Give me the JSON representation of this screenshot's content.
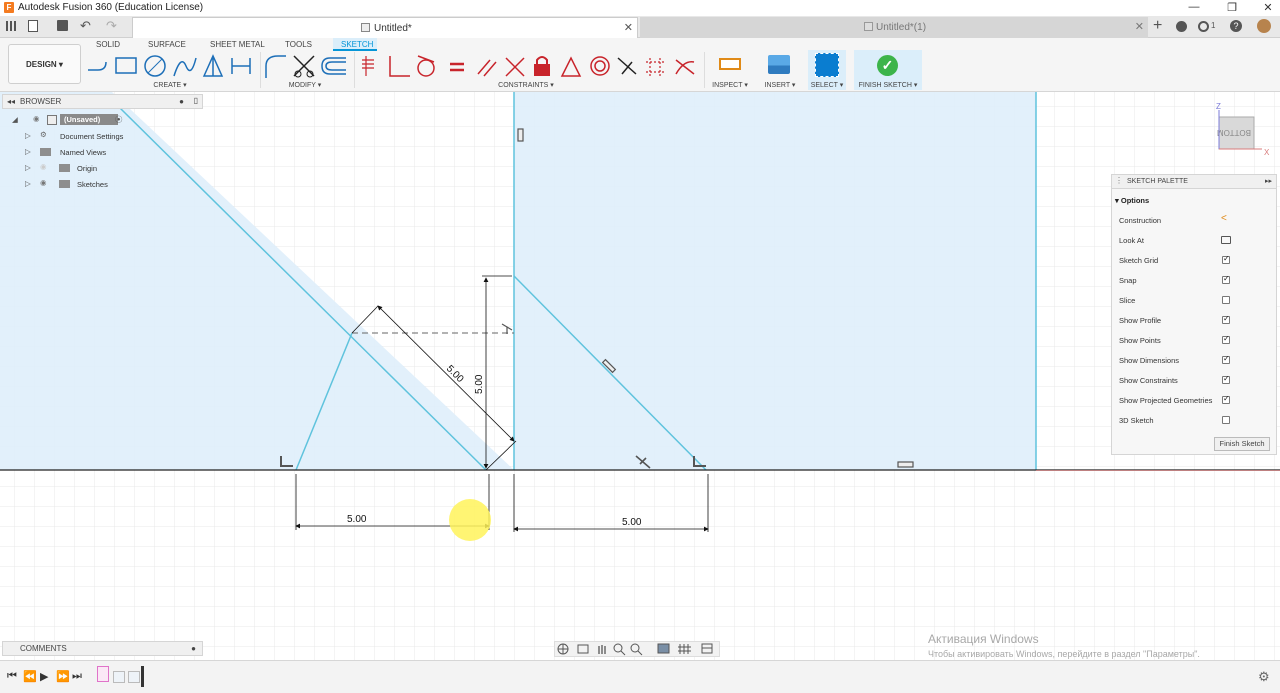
{
  "app": {
    "window_title": "Autodesk Fusion 360 (Education License)",
    "tabs": [
      {
        "label": "Untitled*",
        "active": true
      },
      {
        "label": "Untitled*(1)",
        "active": false
      }
    ],
    "notification_count": "1"
  },
  "ribbon": {
    "workspace": "DESIGN",
    "tabs": [
      "SOLID",
      "SURFACE",
      "SHEET METAL",
      "TOOLS",
      "SKETCH"
    ],
    "active_tab": "SKETCH",
    "groups": [
      "CREATE",
      "MODIFY",
      "CONSTRAINTS",
      "INSPECT",
      "INSERT",
      "SELECT",
      "FINISH SKETCH"
    ]
  },
  "browser": {
    "title": "BROWSER",
    "root": "(Unsaved)",
    "items": [
      "Document Settings",
      "Named Views",
      "Origin",
      "Sketches"
    ]
  },
  "comments": {
    "title": "COMMENTS"
  },
  "view_cube": {
    "face": "BOTTOM",
    "axis_z": "Z",
    "axis_x": "X"
  },
  "sketch_palette": {
    "title": "SKETCH PALETTE",
    "section": "Options",
    "options": [
      {
        "label": "Construction",
        "type": "icon"
      },
      {
        "label": "Look At",
        "type": "icon"
      },
      {
        "label": "Sketch Grid",
        "type": "check",
        "checked": true
      },
      {
        "label": "Snap",
        "type": "check",
        "checked": true
      },
      {
        "label": "Slice",
        "type": "check",
        "checked": false
      },
      {
        "label": "Show Profile",
        "type": "check",
        "checked": true
      },
      {
        "label": "Show Points",
        "type": "check",
        "checked": true
      },
      {
        "label": "Show Dimensions",
        "type": "check",
        "checked": true
      },
      {
        "label": "Show Constraints",
        "type": "check",
        "checked": true
      },
      {
        "label": "Show Projected Geometries",
        "type": "check",
        "checked": true
      },
      {
        "label": "3D Sketch",
        "type": "check",
        "checked": false
      }
    ],
    "finish_button": "Finish Sketch"
  },
  "dimensions": {
    "diag": "5.00",
    "vert": "5.00",
    "left_horiz": "5.00",
    "right_horiz": "5.00"
  },
  "watermark": {
    "line1": "Активация Windows",
    "line2": "Чтобы активировать Windows, перейдите в раздел \"Параметры\"."
  },
  "colors": {
    "profile_fill": "#dfeefb",
    "sketch_line": "#5fc3dd",
    "accent": "#0696d7",
    "finish_green": "#3cb44a"
  }
}
